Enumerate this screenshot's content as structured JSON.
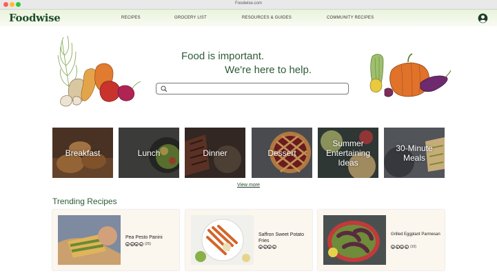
{
  "window": {
    "url": "Foodwise.com"
  },
  "nav": {
    "logo": "Foodwise",
    "links": [
      "RECIPES",
      "GROCERY LIST",
      "RESOURCES & GUIDES",
      "COMMUNITY RECIPES"
    ]
  },
  "hero": {
    "headline_1": "Food is important.",
    "headline_2": "We're here to help.",
    "search_placeholder": ""
  },
  "categories": [
    "Breakfast",
    "Lunch",
    "Dinner",
    "Dessert",
    "Summer Entertaining Ideas",
    "30-Minute Meals"
  ],
  "view_more": "View more",
  "trending": {
    "title": "Trending Recipes",
    "cards": [
      {
        "name": "Pea Pesto Panini",
        "rating_count": "(25)"
      },
      {
        "name": "Saffron Sweet Potato Fries",
        "rating_count": ""
      },
      {
        "name": "Grilled Eggplant Parmesan",
        "rating_count": "(10)"
      }
    ]
  },
  "colors": {
    "brand": "#1f4d2b",
    "accent": "#2d5a36",
    "nav_bg": "#e9f3dc",
    "card_bg": "#fbf6ee"
  },
  "icons": [
    "search-icon",
    "account-icon",
    "star-icon"
  ]
}
